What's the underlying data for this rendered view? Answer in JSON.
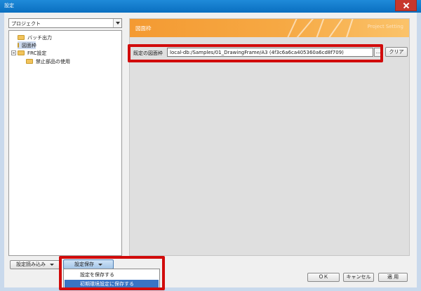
{
  "window": {
    "title": "設定"
  },
  "project_select": {
    "value": "プロジェクト"
  },
  "tree": {
    "items": [
      {
        "label": "バッチ出力"
      },
      {
        "label": "図面枠"
      },
      {
        "label": "FRC設定"
      },
      {
        "label": "禁止部品の使用"
      }
    ]
  },
  "panel": {
    "title": "図面枠",
    "subtitle": "Project Setting",
    "frame_label": "既定の図面枠",
    "frame_path": "local-db:/Samples/01_DrawingFrame/A3 (4f3c6a6ca405360a6cd8f709)",
    "browse_label": "...",
    "clear_label": "クリア"
  },
  "footer": {
    "load_label": "設定読み込み",
    "save_label": "設定保存",
    "save_menu": [
      {
        "label": "設定を保存する"
      },
      {
        "label": "初期環境設定に保存する"
      }
    ],
    "ok_label": "ＯＫ",
    "cancel_label": "キャンセル",
    "apply_label": "適 用"
  },
  "colors": {
    "titlebar": "#0a6fc0",
    "banner": "#f49a32",
    "highlight": "#d10b0b",
    "menu_selected": "#3a74c4"
  }
}
